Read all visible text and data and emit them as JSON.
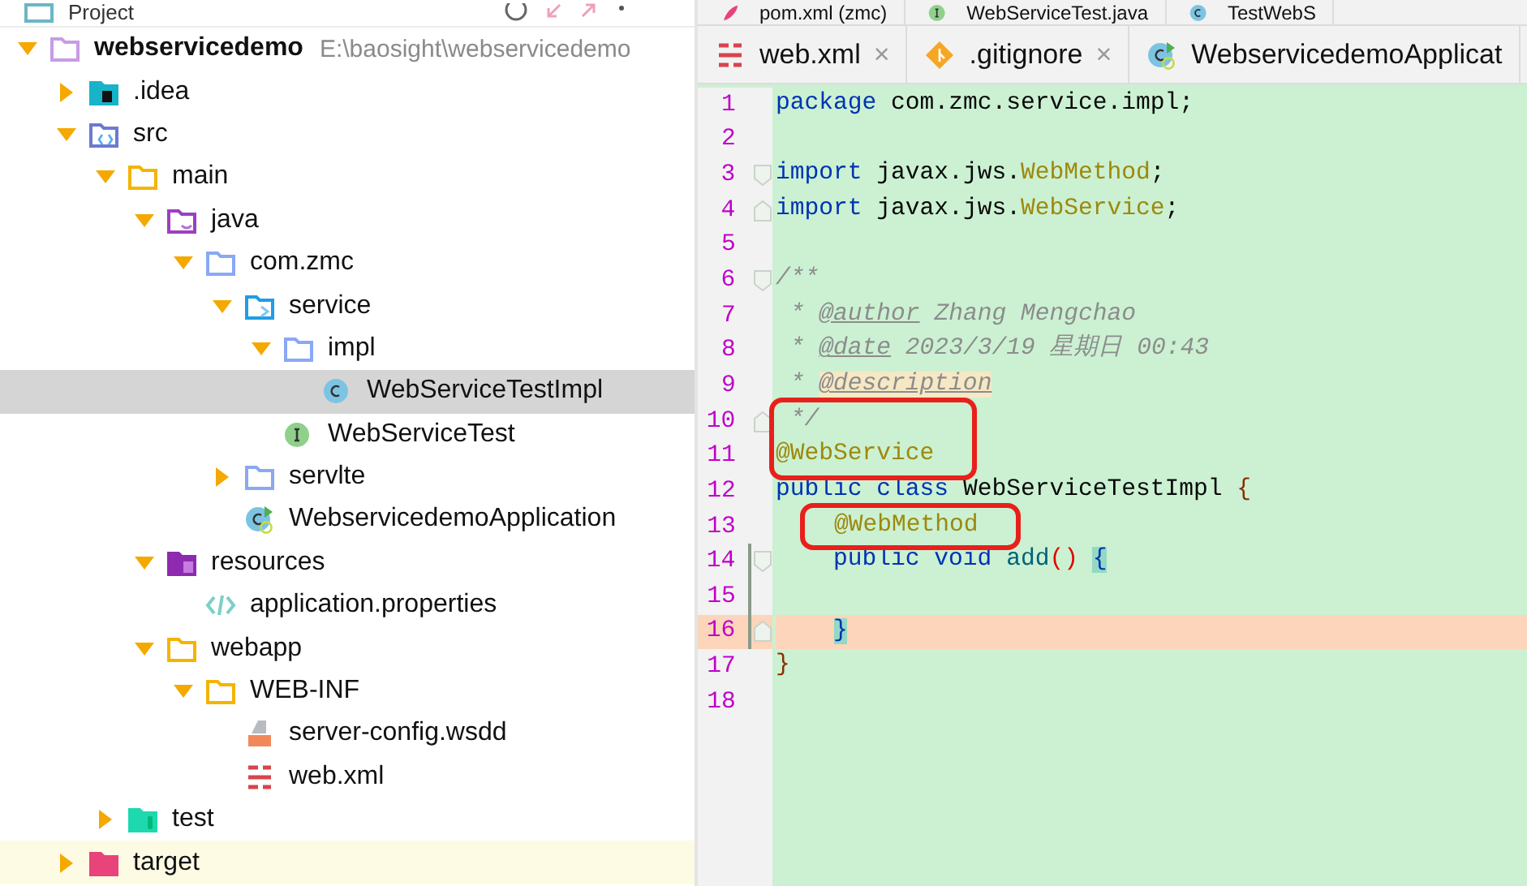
{
  "project_panel": {
    "title": "Project",
    "tree": [
      {
        "name": "webservicedemo",
        "path": "E:\\baosight\\webservicedemo",
        "kind": "module",
        "expanded": true,
        "selected": false,
        "children": [
          {
            "name": ".idea",
            "kind": "idea-folder",
            "expanded": false,
            "selected": false
          },
          {
            "name": "src",
            "kind": "source-root",
            "expanded": true,
            "selected": false,
            "children": [
              {
                "name": "main",
                "kind": "folder",
                "expanded": true,
                "selected": false,
                "children": [
                  {
                    "name": "java",
                    "kind": "java-folder",
                    "expanded": true,
                    "selected": false,
                    "children": [
                      {
                        "name": "com.zmc",
                        "kind": "package",
                        "expanded": true,
                        "selected": false,
                        "children": [
                          {
                            "name": "service",
                            "kind": "service-package",
                            "expanded": true,
                            "selected": false,
                            "children": [
                              {
                                "name": "impl",
                                "kind": "package",
                                "expanded": true,
                                "selected": false,
                                "children": [
                                  {
                                    "name": "WebServiceTestImpl",
                                    "kind": "class",
                                    "selected": true
                                  }
                                ]
                              },
                              {
                                "name": "WebServiceTest",
                                "kind": "interface",
                                "selected": false
                              }
                            ]
                          },
                          {
                            "name": "servlte",
                            "kind": "package",
                            "expanded": false,
                            "selected": false
                          },
                          {
                            "name": "WebservicedemoApplication",
                            "kind": "app-class",
                            "selected": false
                          }
                        ]
                      }
                    ]
                  },
                  {
                    "name": "resources",
                    "kind": "resources-folder",
                    "expanded": true,
                    "selected": false,
                    "children": [
                      {
                        "name": "application.properties",
                        "kind": "properties-file",
                        "selected": false
                      }
                    ]
                  },
                  {
                    "name": "webapp",
                    "kind": "folder",
                    "expanded": true,
                    "selected": false,
                    "children": [
                      {
                        "name": "WEB-INF",
                        "kind": "folder",
                        "expanded": true,
                        "selected": false,
                        "children": [
                          {
                            "name": "server-config.wsdd",
                            "kind": "wsdd-file",
                            "selected": false
                          },
                          {
                            "name": "web.xml",
                            "kind": "xml-file",
                            "selected": false
                          }
                        ]
                      }
                    ]
                  }
                ]
              },
              {
                "name": "test",
                "kind": "test-folder",
                "expanded": false,
                "selected": false
              }
            ]
          },
          {
            "name": "target",
            "kind": "excluded-folder",
            "expanded": false,
            "selected": false
          }
        ]
      }
    ]
  },
  "editor": {
    "tab_rows": [
      [
        {
          "label": "pom.xml (zmc)",
          "kind": "maven-file"
        },
        {
          "label": "WebServiceTest.java",
          "kind": "interface"
        },
        {
          "label": "TestWebS",
          "kind": "class"
        }
      ],
      [
        {
          "label": "web.xml",
          "kind": "xml-file",
          "close": "×"
        },
        {
          "label": ".gitignore",
          "kind": "git-file",
          "close": "×"
        },
        {
          "label": "WebservicedemoApplicat",
          "kind": "app-class"
        }
      ]
    ],
    "blocks": [
      {
        "kind": "line",
        "number": "1",
        "fold_start": false,
        "fold_end": false,
        "changed": false,
        "current": false,
        "indented": false,
        "tokens": [
          {
            "kind": "keyword",
            "text": "package"
          },
          {
            "kind": "plain",
            "text": " com.zmc.service.impl;"
          }
        ]
      },
      {
        "kind": "line",
        "number": "2",
        "fold_start": false,
        "fold_end": false,
        "changed": false,
        "current": false
      },
      {
        "kind": "line",
        "number": "3",
        "fold_start": true,
        "fold_end": false,
        "changed": false,
        "current": false,
        "indented": false,
        "tokens": [
          {
            "kind": "keyword",
            "text": "import"
          },
          {
            "kind": "plain",
            "text": " javax.jws."
          },
          {
            "kind": "annotation",
            "text": "WebMethod"
          },
          {
            "kind": "plain",
            "text": ";"
          }
        ]
      },
      {
        "kind": "line",
        "number": "4",
        "fold_start": false,
        "fold_end": true,
        "changed": false,
        "current": false,
        "indented": false,
        "tokens": [
          {
            "kind": "keyword",
            "text": "import"
          },
          {
            "kind": "plain",
            "text": " javax.jws."
          },
          {
            "kind": "annotation",
            "text": "WebService"
          },
          {
            "kind": "plain",
            "text": ";"
          }
        ]
      },
      {
        "kind": "line",
        "number": "5",
        "fold_start": false,
        "fold_end": false,
        "changed": false,
        "current": false
      },
      {
        "kind": "line",
        "number": "6",
        "fold_start": true,
        "fold_end": false,
        "changed": false,
        "current": false,
        "indented": false,
        "tokens": [
          {
            "kind": "comment",
            "text": "/**"
          }
        ]
      },
      {
        "kind": "line",
        "number": "7",
        "fold_start": false,
        "fold_end": false,
        "changed": false,
        "current": false,
        "indented": false,
        "tokens": [
          {
            "kind": "comment",
            "text": " * "
          },
          {
            "kind": "doctag",
            "text": "@author"
          },
          {
            "kind": "comment",
            "text": " Zhang Mengchao"
          }
        ]
      },
      {
        "kind": "line",
        "number": "8",
        "fold_start": false,
        "fold_end": false,
        "changed": false,
        "current": false,
        "indented": false,
        "tokens": [
          {
            "kind": "comment",
            "text": " * "
          },
          {
            "kind": "doctag",
            "text": "@date"
          },
          {
            "kind": "comment",
            "text": " 2023/3/19 星期日 00:43"
          }
        ]
      },
      {
        "kind": "line",
        "number": "9",
        "fold_start": false,
        "fold_end": false,
        "changed": false,
        "current": false,
        "indented": false,
        "tokens": [
          {
            "kind": "comment",
            "text": " * "
          },
          {
            "kind": "doctag-marked",
            "text": "@description"
          }
        ]
      },
      {
        "kind": "boxed",
        "indented": false,
        "lines": [
          {
            "number": "10",
            "fold_start": false,
            "fold_end": true,
            "changed": false,
            "current": false,
            "tokens": [
              {
                "kind": "comment",
                "text": " */"
              }
            ]
          },
          {
            "number": "11",
            "fold_start": false,
            "fold_end": false,
            "changed": false,
            "current": false,
            "tokens": [
              {
                "kind": "annotation",
                "text": "@WebService"
              }
            ]
          }
        ]
      },
      {
        "kind": "line",
        "number": "12",
        "fold_start": false,
        "fold_end": false,
        "changed": false,
        "current": false,
        "indented": false,
        "tokens": [
          {
            "kind": "keyword",
            "text": "public class"
          },
          {
            "kind": "plain",
            "text": " WebServiceTestImpl "
          },
          {
            "kind": "brace-outer",
            "text": "{"
          }
        ]
      },
      {
        "kind": "boxed",
        "indented": true,
        "lines": [
          {
            "number": "13",
            "fold_start": false,
            "fold_end": false,
            "changed": false,
            "current": false,
            "tokens": [
              {
                "kind": "annotation",
                "text": "@WebMethod"
              }
            ]
          }
        ]
      },
      {
        "kind": "line",
        "number": "14",
        "fold_start": true,
        "fold_end": false,
        "changed": true,
        "current": false,
        "indented": true,
        "tokens": [
          {
            "kind": "keyword",
            "text": "public void "
          },
          {
            "kind": "method",
            "text": "add"
          },
          {
            "kind": "paren",
            "text": "() "
          },
          {
            "kind": "brace-matched",
            "text": "{"
          }
        ]
      },
      {
        "kind": "line",
        "number": "15",
        "fold_start": false,
        "fold_end": false,
        "changed": true,
        "current": false
      },
      {
        "kind": "line",
        "number": "16",
        "fold_start": false,
        "fold_end": true,
        "changed": true,
        "current": true,
        "indented": true,
        "tokens": [
          {
            "kind": "brace-matched",
            "text": "}"
          }
        ]
      },
      {
        "kind": "line",
        "number": "17",
        "fold_start": false,
        "fold_end": false,
        "changed": false,
        "current": false,
        "indented": false,
        "tokens": [
          {
            "kind": "brace-outer",
            "text": "}"
          }
        ]
      },
      {
        "kind": "line",
        "number": "18",
        "fold_start": false,
        "fold_end": false,
        "changed": false,
        "current": false
      }
    ]
  }
}
